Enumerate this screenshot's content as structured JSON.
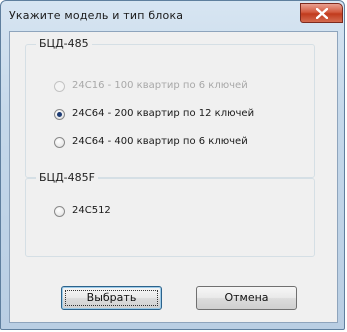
{
  "window": {
    "title": "Укажите модель и тип блока"
  },
  "groups": [
    {
      "legend": "БЦД-485",
      "options": [
        {
          "label": "24C16 - 100 квартир по 6 ключей",
          "checked": false,
          "disabled": true
        },
        {
          "label": "24C64 - 200 квартир по 12 ключей",
          "checked": true,
          "disabled": false
        },
        {
          "label": "24C64 - 400 квартир по 6 ключей",
          "checked": false,
          "disabled": false
        }
      ]
    },
    {
      "legend": "БЦД-485F",
      "options": [
        {
          "label": "24C512",
          "checked": false,
          "disabled": false
        }
      ]
    }
  ],
  "buttons": {
    "ok_label": "Выбрать",
    "cancel_label": "Отмена"
  },
  "icons": {
    "close": "close-icon"
  },
  "colors": {
    "close_button": "#c94a2c",
    "title_bar": "#c5d8ea",
    "dialog_background": "#f0f0f0"
  }
}
